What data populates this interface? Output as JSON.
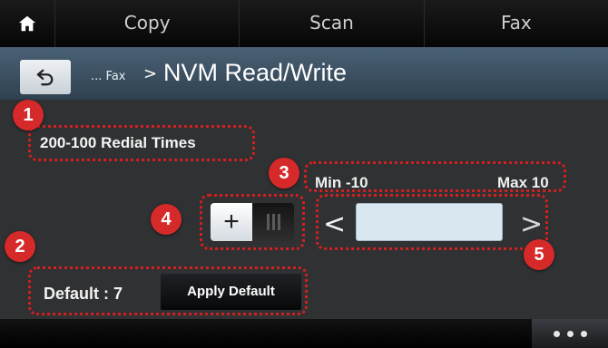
{
  "nav": {
    "home_icon": "home-icon",
    "tabs": [
      {
        "label": "Copy"
      },
      {
        "label": "Scan"
      },
      {
        "label": "Fax"
      }
    ]
  },
  "path": {
    "back_icon": "back-arrow-icon",
    "prefix": "... Fax",
    "separator": ">",
    "title": "NVM Read/Write"
  },
  "setting": {
    "label": "200-100 Redial Times",
    "min_label": "Min -10",
    "max_label": "Max 10",
    "sign_toggle": {
      "plus": "+",
      "minus_icon": "minus-bars-icon",
      "selected": "+"
    },
    "value": "",
    "left_arrow": "<",
    "right_arrow": ">",
    "default_label": "Default : 7",
    "apply_default_label": "Apply Default"
  },
  "callouts": [
    "1",
    "2",
    "3",
    "4",
    "5"
  ],
  "more_icon": "more-dots-icon",
  "colors": {
    "callout": "#d62a2a",
    "path_bar": "#3f5466",
    "value_field": "#d9e7f1"
  }
}
